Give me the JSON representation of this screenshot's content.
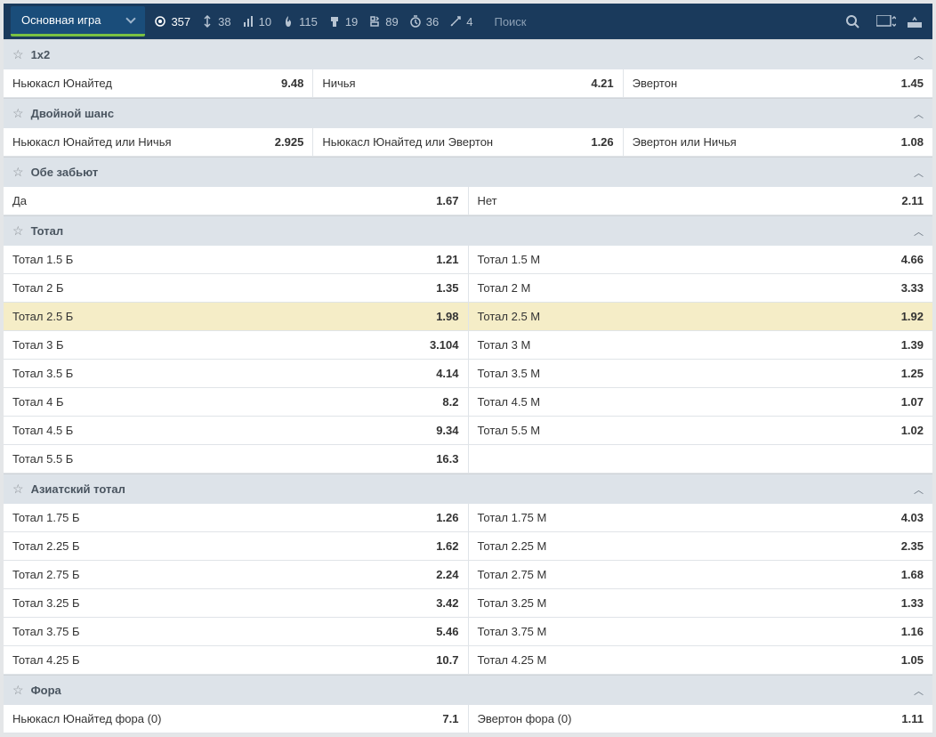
{
  "topbar": {
    "dropdown_label": "Основная игра",
    "search_placeholder": "Поиск",
    "filters": [
      {
        "count": "357",
        "active": true
      },
      {
        "count": "38"
      },
      {
        "count": "10"
      },
      {
        "count": "115"
      },
      {
        "count": "19"
      },
      {
        "count": "89"
      },
      {
        "count": "36"
      },
      {
        "count": "4"
      }
    ]
  },
  "markets": [
    {
      "title": "1x2",
      "cols": 3,
      "rows": [
        [
          {
            "label": "Ньюкасл Юнайтед",
            "odds": "9.48"
          },
          {
            "label": "Ничья",
            "odds": "4.21"
          },
          {
            "label": "Эвертон",
            "odds": "1.45"
          }
        ]
      ]
    },
    {
      "title": "Двойной шанс",
      "cols": 3,
      "rows": [
        [
          {
            "label": "Ньюкасл Юнайтед или Ничья",
            "odds": "2.925"
          },
          {
            "label": "Ньюкасл Юнайтед или Эвертон",
            "odds": "1.26"
          },
          {
            "label": "Эвертон или Ничья",
            "odds": "1.08"
          }
        ]
      ]
    },
    {
      "title": "Обе забьют",
      "cols": 2,
      "rows": [
        [
          {
            "label": "Да",
            "odds": "1.67"
          },
          {
            "label": "Нет",
            "odds": "2.11"
          }
        ]
      ]
    },
    {
      "title": "Тотал",
      "cols": 2,
      "rows": [
        [
          {
            "label": "Тотал 1.5 Б",
            "odds": "1.21"
          },
          {
            "label": "Тотал 1.5 М",
            "odds": "4.66"
          }
        ],
        [
          {
            "label": "Тотал 2 Б",
            "odds": "1.35"
          },
          {
            "label": "Тотал 2 М",
            "odds": "3.33"
          }
        ],
        [
          {
            "label": "Тотал 2.5 Б",
            "odds": "1.98",
            "highlighted": true
          },
          {
            "label": "Тотал 2.5 М",
            "odds": "1.92",
            "highlighted": true
          }
        ],
        [
          {
            "label": "Тотал 3 Б",
            "odds": "3.104"
          },
          {
            "label": "Тотал 3 М",
            "odds": "1.39"
          }
        ],
        [
          {
            "label": "Тотал 3.5 Б",
            "odds": "4.14"
          },
          {
            "label": "Тотал 3.5 М",
            "odds": "1.25"
          }
        ],
        [
          {
            "label": "Тотал 4 Б",
            "odds": "8.2"
          },
          {
            "label": "Тотал 4.5 М",
            "odds": "1.07"
          }
        ],
        [
          {
            "label": "Тотал 4.5 Б",
            "odds": "9.34"
          },
          {
            "label": "Тотал 5.5 М",
            "odds": "1.02"
          }
        ],
        [
          {
            "label": "Тотал 5.5 Б",
            "odds": "16.3"
          },
          {
            "label": "",
            "odds": ""
          }
        ]
      ]
    },
    {
      "title": "Азиатский тотал",
      "cols": 2,
      "rows": [
        [
          {
            "label": "Тотал 1.75 Б",
            "odds": "1.26"
          },
          {
            "label": "Тотал 1.75 М",
            "odds": "4.03"
          }
        ],
        [
          {
            "label": "Тотал 2.25 Б",
            "odds": "1.62"
          },
          {
            "label": "Тотал 2.25 М",
            "odds": "2.35"
          }
        ],
        [
          {
            "label": "Тотал 2.75 Б",
            "odds": "2.24"
          },
          {
            "label": "Тотал 2.75 М",
            "odds": "1.68"
          }
        ],
        [
          {
            "label": "Тотал 3.25 Б",
            "odds": "3.42"
          },
          {
            "label": "Тотал 3.25 М",
            "odds": "1.33"
          }
        ],
        [
          {
            "label": "Тотал 3.75 Б",
            "odds": "5.46"
          },
          {
            "label": "Тотал 3.75 М",
            "odds": "1.16"
          }
        ],
        [
          {
            "label": "Тотал 4.25 Б",
            "odds": "10.7"
          },
          {
            "label": "Тотал 4.25 М",
            "odds": "1.05"
          }
        ]
      ]
    },
    {
      "title": "Фора",
      "cols": 2,
      "rows": [
        [
          {
            "label": "Ньюкасл Юнайтед фора (0)",
            "odds": "7.1"
          },
          {
            "label": "Эвертон фора (0)",
            "odds": "1.11"
          }
        ]
      ]
    }
  ]
}
